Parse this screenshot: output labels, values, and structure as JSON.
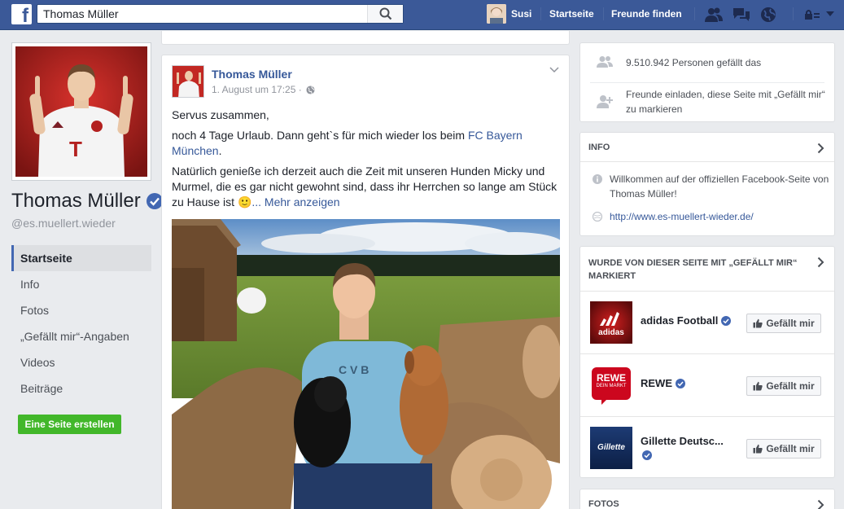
{
  "topbar": {
    "logo": "f",
    "search_value": "Thomas Müller",
    "user_name": "Susi",
    "home_link": "Startseite",
    "find_friends_link": "Freunde finden"
  },
  "profile": {
    "name": "Thomas Müller",
    "handle": "@es.muellert.wieder"
  },
  "left_nav": {
    "items": [
      {
        "label": "Startseite",
        "active": true
      },
      {
        "label": "Info"
      },
      {
        "label": "Fotos"
      },
      {
        "label": "„Gefällt mir“-Angaben"
      },
      {
        "label": "Videos"
      },
      {
        "label": "Beiträge"
      }
    ],
    "create_page_label": "Eine Seite erstellen"
  },
  "post": {
    "author": "Thomas Müller",
    "timestamp": "1. August um 17:25 ·",
    "line1": "Servus zusammen,",
    "line2_pre": "noch 4 Tage Urlaub. Dann geht`s für mich wieder los beim ",
    "line2_link": "FC Bayern München",
    "line2_post": ".",
    "line3": "Natürlich genieße ich derzeit auch die Zeit mit unseren Hunden Micky und Murmel, die es gar nicht gewohnt sind, dass ihr Herrchen so lange am Stück zu Hause ist ",
    "emoji": "🙂",
    "more_link": "... Mehr anzeigen"
  },
  "right": {
    "likes_count_text": "9.510.942 Personen gefällt das",
    "invite_text": "Freunde einladen, diese Seite mit „Gefällt mir“ zu markieren",
    "info_header": "INFO",
    "info_welcome": "Willkommen auf der offiziellen Facebook-Seite von Thomas Müller!",
    "info_url": "http://www.es-muellert-wieder.de/",
    "liked_header": "WURDE VON DIESER SEITE MIT „GEFÄLLT MIR“ MARKIERT",
    "liked_pages": [
      {
        "name": "adidas Football",
        "logo_text": "adidas",
        "button": "Gefällt mir"
      },
      {
        "name": "REWE",
        "logo_text": "REWE",
        "logo_sub": "DEIN MARKT",
        "button": "Gefällt mir"
      },
      {
        "name": "Gillette Deutsc...",
        "logo_text": "Gillette",
        "button": "Gefällt mir"
      }
    ],
    "photos_header": "FOTOS"
  },
  "colors": {
    "brand": "#3b5998",
    "link": "#365899",
    "green": "#42b72a",
    "verified": "#4267b2"
  }
}
